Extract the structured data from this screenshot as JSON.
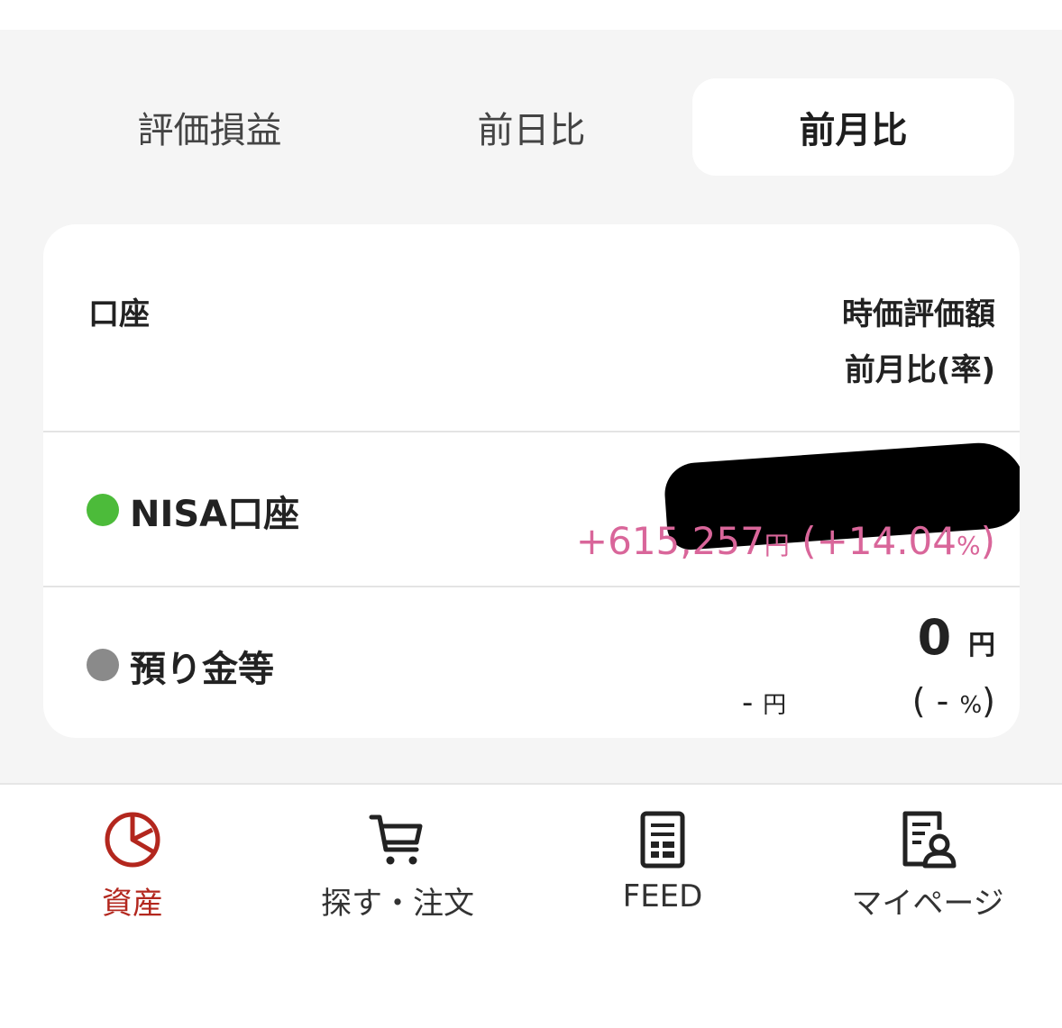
{
  "segments": [
    {
      "label": "評価損益",
      "active": false
    },
    {
      "label": "前日比",
      "active": false
    },
    {
      "label": "前月比",
      "active": true
    }
  ],
  "table": {
    "header_left": "口座",
    "header_right_line1": "時価評価額",
    "header_right_line2": "前月比(率)"
  },
  "rows": [
    {
      "name": "NISA口座",
      "dot_color": "#4cbb3a",
      "change_amount": "+615,257",
      "change_unit": "円",
      "change_rate_open": "(",
      "change_rate": "+14.04",
      "change_rate_unit": "%",
      "change_rate_close": ")"
    },
    {
      "name": "預り金等",
      "dot_color": "#8a8a8a",
      "value": "0",
      "value_unit": "円",
      "change_amount": "-",
      "change_unit": "円",
      "change_rate_open": "(",
      "change_rate": "-",
      "change_rate_unit": "%",
      "change_rate_close": ")"
    }
  ],
  "tabbar": [
    {
      "label": "資産",
      "icon": "pie-chart-icon",
      "active": true
    },
    {
      "label": "探す・注文",
      "icon": "cart-icon",
      "active": false
    },
    {
      "label": "FEED",
      "icon": "document-icon",
      "active": false
    },
    {
      "label": "マイページ",
      "icon": "profile-document-icon",
      "active": false
    }
  ],
  "colors": {
    "accent": "#b3271e",
    "positive": "#d9669a",
    "background": "#f5f5f5"
  }
}
